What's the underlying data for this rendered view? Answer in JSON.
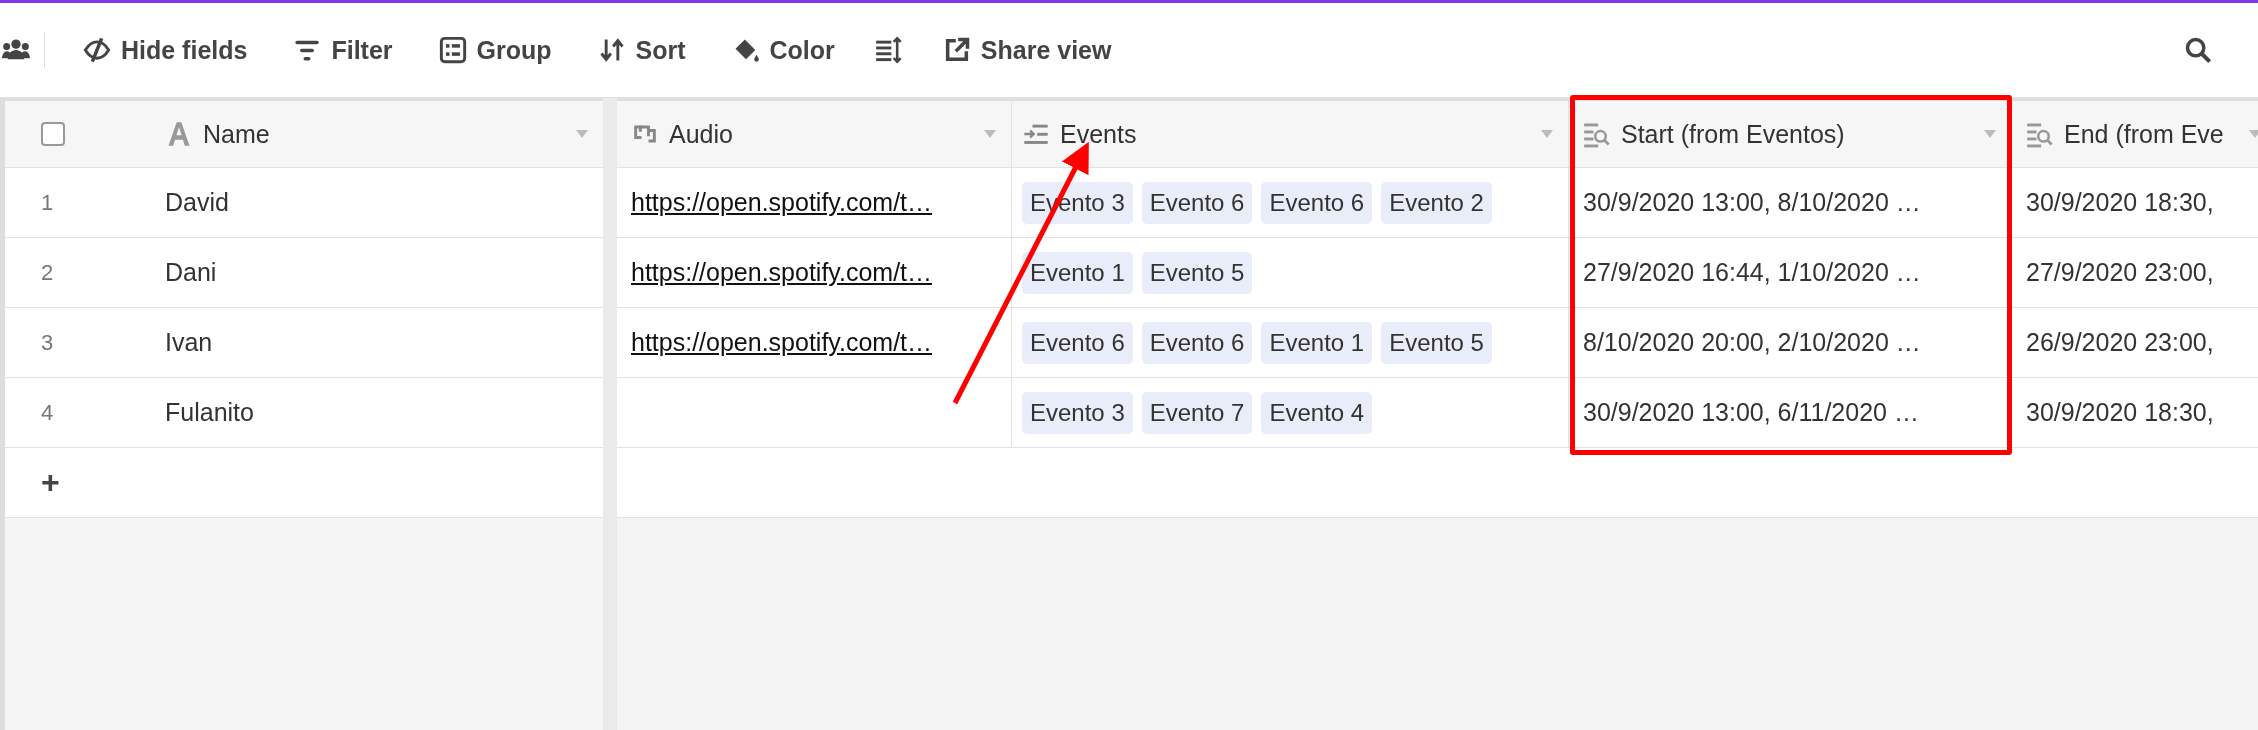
{
  "toolbar": {
    "items": [
      {
        "kind": "people"
      },
      {
        "kind": "hide",
        "label": "Hide fields"
      },
      {
        "kind": "filter",
        "label": "Filter"
      },
      {
        "kind": "group",
        "label": "Group"
      },
      {
        "kind": "sort",
        "label": "Sort"
      },
      {
        "kind": "color",
        "label": "Color"
      },
      {
        "kind": "height"
      },
      {
        "kind": "share",
        "label": "Share view"
      }
    ]
  },
  "table": {
    "select_all": {
      "checked": false
    },
    "columns": [
      {
        "kind": "text",
        "label": "Name"
      },
      {
        "kind": "url",
        "label": "Audio"
      },
      {
        "kind": "link",
        "label": "Events"
      },
      {
        "kind": "lookup",
        "label": "Start (from Eventos)"
      },
      {
        "kind": "lookup",
        "label": "End (from Eve"
      }
    ],
    "rows": [
      {
        "number": "1",
        "name": "David",
        "audio": "https://open.spotify.com/t…",
        "events": [
          "Evento 3",
          "Evento 6",
          "Evento 6",
          "Evento 2"
        ],
        "start": "30/9/2020 13:00, 8/10/2020 …",
        "end": "30/9/2020 18:30,"
      },
      {
        "number": "2",
        "name": "Dani",
        "audio": "https://open.spotify.com/t…",
        "events": [
          "Evento 1",
          "Evento 5"
        ],
        "start": "27/9/2020 16:44, 1/10/2020 …",
        "end": "27/9/2020 23:00,"
      },
      {
        "number": "3",
        "name": "Ivan",
        "audio": "https://open.spotify.com/t…",
        "events": [
          "Evento 6",
          "Evento 6",
          "Evento 1",
          "Evento 5"
        ],
        "start": "8/10/2020 20:00, 2/10/2020 …",
        "end": "26/9/2020 23:00,"
      },
      {
        "number": "4",
        "name": "Fulanito",
        "events": [
          "Evento 3",
          "Evento 7",
          "Evento 4"
        ],
        "start": "30/9/2020 13:00, 6/11/2020 …",
        "end": "30/9/2020 18:30,"
      }
    ],
    "add_row": "+"
  }
}
